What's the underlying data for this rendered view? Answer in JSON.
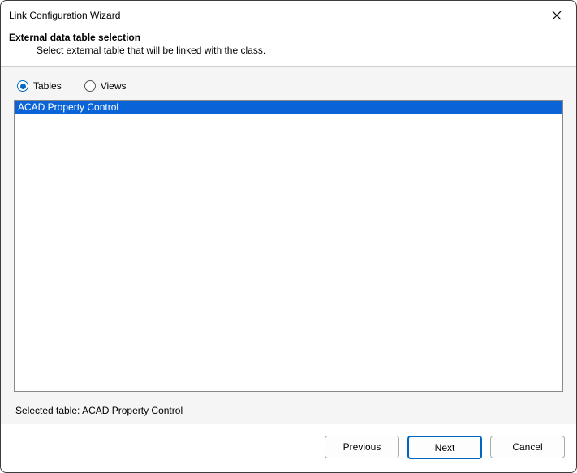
{
  "window": {
    "title": "Link Configuration Wizard"
  },
  "header": {
    "heading": "External data table selection",
    "sub": "Select external table that will be linked with the class."
  },
  "radios": {
    "tables": "Tables",
    "views": "Views",
    "selected": "tables"
  },
  "list": {
    "items": [
      "ACAD Property Control"
    ],
    "selected_index": 0
  },
  "selected_label_prefix": "Selected table:  ",
  "selected_value": "ACAD Property Control",
  "buttons": {
    "previous": "Previous",
    "next": "Next",
    "cancel": "Cancel"
  }
}
